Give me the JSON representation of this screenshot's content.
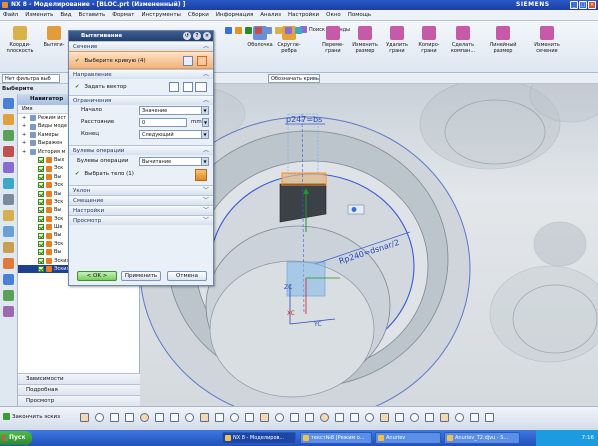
{
  "window": {
    "title": "NX 8 - Моделирование - [BLOC.prt (Измененный) ]",
    "brand": "SIEMENS",
    "controls": [
      "_",
      "□",
      "×"
    ]
  },
  "menubar": [
    "Файл",
    "Изменить",
    "Вид",
    "Вставить",
    "Формат",
    "Инструменты",
    "Сборки",
    "Информация",
    "Анализ",
    "Настройки",
    "Окно",
    "Помощь"
  ],
  "ribbon": {
    "big_buttons": [
      {
        "label": "Коорди-\nплоскость",
        "color": "#d8b24a"
      },
      {
        "label": "Вытяги-",
        "color": "#e39b3c"
      },
      {
        "label": "Оболочка",
        "color": "#6b8fd6"
      },
      {
        "label": "Скругле-\nребра",
        "color": "#e3a33c"
      },
      {
        "label": "Переме-\nграни",
        "color": "#c65aa8"
      },
      {
        "label": "Изменить\nразмер",
        "color": "#c65aa8"
      },
      {
        "label": "Удалить\nграни",
        "color": "#c65aa8"
      },
      {
        "label": "Копиро-\nграни",
        "color": "#c65aa8"
      },
      {
        "label": "Сделать\nкомпан...",
        "color": "#c65aa8"
      },
      {
        "label": "Линейный\nразмер",
        "color": "#c65aa8"
      },
      {
        "label": "Изменить\nсечение",
        "color": "#c65aa8"
      }
    ],
    "search_label": "Поиск команды",
    "snap_label": "Обозначать кривы"
  },
  "filter": {
    "value": "Нет фильтра выб"
  },
  "geometry_label": "Выберите геометрию",
  "navigator": {
    "title": "Навигатор",
    "column_header": "Имя",
    "items": [
      {
        "label": "Режим ист",
        "type": "mode",
        "indent": 4
      },
      {
        "label": "Виды моде",
        "type": "views",
        "indent": 4
      },
      {
        "label": "Камеры",
        "type": "camera",
        "indent": 4
      },
      {
        "label": "Выражен",
        "type": "expr",
        "indent": 4
      },
      {
        "label": "История м",
        "type": "history",
        "indent": 4
      },
      {
        "label": "Вых",
        "type": "feat",
        "indent": 20
      },
      {
        "label": "Эск",
        "type": "feat",
        "indent": 20
      },
      {
        "label": "Вы",
        "type": "feat",
        "indent": 20
      },
      {
        "label": "Эск",
        "type": "feat",
        "indent": 20
      },
      {
        "label": "Вы",
        "type": "feat",
        "indent": 20
      },
      {
        "label": "Эск",
        "type": "feat",
        "indent": 20
      },
      {
        "label": "Вы",
        "type": "feat",
        "indent": 20
      },
      {
        "label": "Эск",
        "type": "feat",
        "indent": 20
      },
      {
        "label": "Шв",
        "type": "feat",
        "indent": 20
      },
      {
        "label": "Вы",
        "type": "feat",
        "indent": 20
      },
      {
        "label": "Эск",
        "type": "feat",
        "indent": 20
      },
      {
        "label": "Вы",
        "type": "feat",
        "indent": 20
      },
      {
        "label": "Эскиз (10) \"SKETCH_00...",
        "type": "feat",
        "indent": 20
      },
      {
        "label": "Эскиз (11) \"SKETCH_0...",
        "type": "feat-selected",
        "indent": 20
      }
    ],
    "bottom_sections": [
      "Зависимости",
      "Подробная",
      "Просмотр"
    ]
  },
  "dialog": {
    "title": "Вытягивание",
    "sections": {
      "section": "Сечение",
      "direction": "Направление",
      "limits": "Ограничения",
      "boolean": "Булевы операции",
      "draft": "Уклон",
      "offset": "Смещение",
      "settings": "Настройки",
      "preview": "Просмотр"
    },
    "select_curve": "Выберите кривую (4)",
    "specify_vector": "Задать вектор",
    "start_label": "Начало",
    "start_value": "Значение",
    "distance_label": "Расстояние",
    "distance_value": "0",
    "distance_unit": "mm",
    "end_label": "Конец",
    "end_value": "Следующий",
    "boolean_label": "Булевы операции",
    "boolean_value": "Вычитание",
    "select_body": "Выбрать тело (1)",
    "ok_button": "< OK >",
    "apply_button": "Применить",
    "cancel_button": "Отмена"
  },
  "viewport": {
    "dim1": "p247=bs",
    "dim2": "Rp240=dsnar/2",
    "axis_zc": "ZC",
    "axis_yc": "YC",
    "axis_xc": "XC"
  },
  "sketchbar": {
    "finish_label": "Закончить эскиз"
  },
  "taskbar": {
    "start": "Пуск",
    "tasks": [
      {
        "label": "NX 8 - Моделиров...",
        "active": true
      },
      {
        "label": "текст№8 [Режим о...",
        "active": false
      },
      {
        "label": "Anuriev",
        "active": false
      },
      {
        "label": "Anuriev_T2.djvu - S...",
        "active": false
      }
    ],
    "clock": "7:16"
  }
}
